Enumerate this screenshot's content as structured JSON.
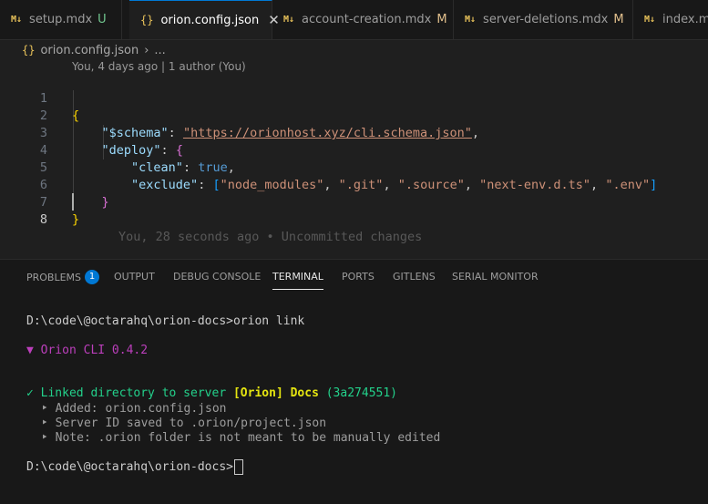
{
  "tabs": [
    {
      "icon": "markdown-icon",
      "label": "setup.mdx",
      "status": "U",
      "active": false
    },
    {
      "icon": "json-icon",
      "label": "orion.config.json",
      "status": "",
      "active": true
    },
    {
      "icon": "markdown-icon",
      "label": "account-creation.mdx",
      "status": "M",
      "active": false
    },
    {
      "icon": "markdown-icon",
      "label": "server-deletions.mdx",
      "status": "M",
      "active": false
    },
    {
      "icon": "markdown-icon",
      "label": "index.mdx",
      "status": "",
      "active": false
    }
  ],
  "icons": {
    "markdown": "M↓",
    "json": "{}",
    "close": "✕",
    "chevron": "›"
  },
  "breadcrumb": {
    "file": "orion.config.json",
    "rest": "..."
  },
  "blame_header": "You, 4 days ago | 1 author (You)",
  "editor": {
    "line_numbers": [
      "1",
      "2",
      "3",
      "4",
      "5",
      "6",
      "7",
      "8"
    ],
    "current_line": "8",
    "schema_key": "\"$schema\"",
    "schema_value": "\"https://orionhost.xyz/cli.schema.json\"",
    "deploy_key": "\"deploy\"",
    "clean_key": "\"clean\"",
    "clean_value": "true",
    "exclude_key": "\"exclude\"",
    "exclude_values": [
      "\"node_modules\"",
      "\".git\"",
      "\".source\"",
      "\"next-env.d.ts\"",
      "\".env\""
    ],
    "inline_blame": "You, 28 seconds ago • Uncommitted changes"
  },
  "panel_tabs": [
    {
      "label": "PROBLEMS",
      "badge": "1"
    },
    {
      "label": "OUTPUT"
    },
    {
      "label": "DEBUG CONSOLE"
    },
    {
      "label": "TERMINAL",
      "active": true
    },
    {
      "label": "PORTS"
    },
    {
      "label": "GITLENS"
    },
    {
      "label": "SERIAL MONITOR"
    }
  ],
  "terminal": {
    "command_line": "D:\\code\\@octarahq\\orion-docs>orion link",
    "cli_header": "▼ Orion CLI 0.4.2",
    "linked_prefix": "✓ Linked directory to server ",
    "linked_server": "[Orion] Docs",
    "linked_id": " (3a274551)",
    "details": [
      "‣ Added: orion.config.json",
      "‣ Server ID saved to .orion/project.json",
      "‣ Note: .orion folder is not meant to be manually edited"
    ],
    "prompt": "D:\\code\\@octarahq\\orion-docs>"
  }
}
